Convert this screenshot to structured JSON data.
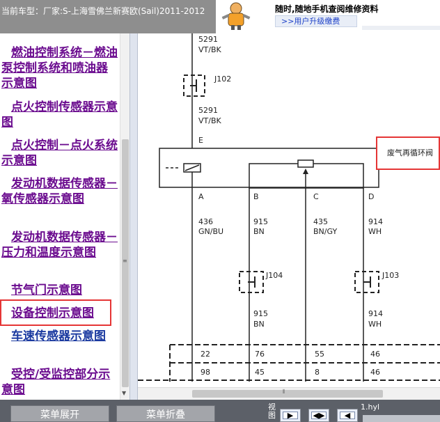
{
  "header": {
    "vehicle_info": "当前车型：厂家:S-上海雪佛兰新赛欧(Sail)2011-2012"
  },
  "ad": {
    "line1": "随时,随地手机查阅维修资料",
    "link_text": ">>用户升级缴费"
  },
  "menu": {
    "items": [
      {
        "label": "燃油控制系统－燃油泵控制系统和喷油器示意图",
        "color": "#6b0c8f"
      },
      {
        "label": "点火控制传感器示意图",
        "color": "#6b0c8f"
      },
      {
        "label": "点火控制－点火系统示意图",
        "color": "#6b0c8f"
      },
      {
        "label": "发动机数据传感器－氧传感器示意图",
        "color": "#6b0c8f"
      },
      {
        "label": "发动机数据传感器－压力和温度示意图",
        "color": "#6b0c8f"
      },
      {
        "label": "节气门示意图",
        "color": "#6b0c8f"
      },
      {
        "label": "设备控制示意图",
        "color": "#6b0c8f",
        "selected": true
      },
      {
        "label": "车速传感器示意图",
        "color": "#1b3aa0"
      },
      {
        "label": "受控/受监控部分示意图",
        "color": "#6b0c8f"
      }
    ]
  },
  "diagram": {
    "top_wire": {
      "circuit": "5291",
      "color": "VT/BK"
    },
    "j102": "J102",
    "mid_wire": {
      "circuit": "5291",
      "color": "VT/BK"
    },
    "pin_e": "E",
    "component": "废气再循环阀",
    "pins": [
      {
        "pin": "A",
        "circuit": "436",
        "color": "GN/BU"
      },
      {
        "pin": "B",
        "circuit": "915",
        "color": "BN"
      },
      {
        "pin": "C",
        "circuit": "435",
        "color": "BN/GY"
      },
      {
        "pin": "D",
        "circuit": "914",
        "color": "WH"
      }
    ],
    "j104": "J104",
    "j103": "J103",
    "lower_b": {
      "circuit": "915",
      "color": "BN"
    },
    "lower_d": {
      "circuit": "914",
      "color": "WH"
    },
    "connector_row1": [
      "22",
      "76",
      "55",
      "46"
    ],
    "connector_row2": [
      "98",
      "45",
      "8",
      "46"
    ]
  },
  "bottom": {
    "expand_label": "菜单展开",
    "collapse_label": "菜单折叠",
    "view_label": "视图",
    "file_label": "1.hyl"
  }
}
